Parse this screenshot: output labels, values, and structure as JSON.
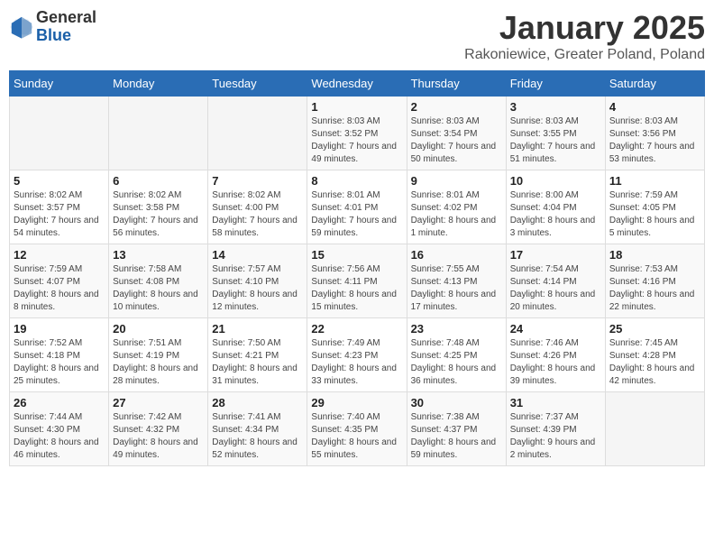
{
  "logo": {
    "line1": "General",
    "line2": "Blue"
  },
  "title": "January 2025",
  "subtitle": "Rakoniewice, Greater Poland, Poland",
  "weekdays": [
    "Sunday",
    "Monday",
    "Tuesday",
    "Wednesday",
    "Thursday",
    "Friday",
    "Saturday"
  ],
  "weeks": [
    [
      {
        "day": "",
        "sunrise": "",
        "sunset": "",
        "daylight": ""
      },
      {
        "day": "",
        "sunrise": "",
        "sunset": "",
        "daylight": ""
      },
      {
        "day": "",
        "sunrise": "",
        "sunset": "",
        "daylight": ""
      },
      {
        "day": "1",
        "sunrise": "Sunrise: 8:03 AM",
        "sunset": "Sunset: 3:52 PM",
        "daylight": "Daylight: 7 hours and 49 minutes."
      },
      {
        "day": "2",
        "sunrise": "Sunrise: 8:03 AM",
        "sunset": "Sunset: 3:54 PM",
        "daylight": "Daylight: 7 hours and 50 minutes."
      },
      {
        "day": "3",
        "sunrise": "Sunrise: 8:03 AM",
        "sunset": "Sunset: 3:55 PM",
        "daylight": "Daylight: 7 hours and 51 minutes."
      },
      {
        "day": "4",
        "sunrise": "Sunrise: 8:03 AM",
        "sunset": "Sunset: 3:56 PM",
        "daylight": "Daylight: 7 hours and 53 minutes."
      }
    ],
    [
      {
        "day": "5",
        "sunrise": "Sunrise: 8:02 AM",
        "sunset": "Sunset: 3:57 PM",
        "daylight": "Daylight: 7 hours and 54 minutes."
      },
      {
        "day": "6",
        "sunrise": "Sunrise: 8:02 AM",
        "sunset": "Sunset: 3:58 PM",
        "daylight": "Daylight: 7 hours and 56 minutes."
      },
      {
        "day": "7",
        "sunrise": "Sunrise: 8:02 AM",
        "sunset": "Sunset: 4:00 PM",
        "daylight": "Daylight: 7 hours and 58 minutes."
      },
      {
        "day": "8",
        "sunrise": "Sunrise: 8:01 AM",
        "sunset": "Sunset: 4:01 PM",
        "daylight": "Daylight: 7 hours and 59 minutes."
      },
      {
        "day": "9",
        "sunrise": "Sunrise: 8:01 AM",
        "sunset": "Sunset: 4:02 PM",
        "daylight": "Daylight: 8 hours and 1 minute."
      },
      {
        "day": "10",
        "sunrise": "Sunrise: 8:00 AM",
        "sunset": "Sunset: 4:04 PM",
        "daylight": "Daylight: 8 hours and 3 minutes."
      },
      {
        "day": "11",
        "sunrise": "Sunrise: 7:59 AM",
        "sunset": "Sunset: 4:05 PM",
        "daylight": "Daylight: 8 hours and 5 minutes."
      }
    ],
    [
      {
        "day": "12",
        "sunrise": "Sunrise: 7:59 AM",
        "sunset": "Sunset: 4:07 PM",
        "daylight": "Daylight: 8 hours and 8 minutes."
      },
      {
        "day": "13",
        "sunrise": "Sunrise: 7:58 AM",
        "sunset": "Sunset: 4:08 PM",
        "daylight": "Daylight: 8 hours and 10 minutes."
      },
      {
        "day": "14",
        "sunrise": "Sunrise: 7:57 AM",
        "sunset": "Sunset: 4:10 PM",
        "daylight": "Daylight: 8 hours and 12 minutes."
      },
      {
        "day": "15",
        "sunrise": "Sunrise: 7:56 AM",
        "sunset": "Sunset: 4:11 PM",
        "daylight": "Daylight: 8 hours and 15 minutes."
      },
      {
        "day": "16",
        "sunrise": "Sunrise: 7:55 AM",
        "sunset": "Sunset: 4:13 PM",
        "daylight": "Daylight: 8 hours and 17 minutes."
      },
      {
        "day": "17",
        "sunrise": "Sunrise: 7:54 AM",
        "sunset": "Sunset: 4:14 PM",
        "daylight": "Daylight: 8 hours and 20 minutes."
      },
      {
        "day": "18",
        "sunrise": "Sunrise: 7:53 AM",
        "sunset": "Sunset: 4:16 PM",
        "daylight": "Daylight: 8 hours and 22 minutes."
      }
    ],
    [
      {
        "day": "19",
        "sunrise": "Sunrise: 7:52 AM",
        "sunset": "Sunset: 4:18 PM",
        "daylight": "Daylight: 8 hours and 25 minutes."
      },
      {
        "day": "20",
        "sunrise": "Sunrise: 7:51 AM",
        "sunset": "Sunset: 4:19 PM",
        "daylight": "Daylight: 8 hours and 28 minutes."
      },
      {
        "day": "21",
        "sunrise": "Sunrise: 7:50 AM",
        "sunset": "Sunset: 4:21 PM",
        "daylight": "Daylight: 8 hours and 31 minutes."
      },
      {
        "day": "22",
        "sunrise": "Sunrise: 7:49 AM",
        "sunset": "Sunset: 4:23 PM",
        "daylight": "Daylight: 8 hours and 33 minutes."
      },
      {
        "day": "23",
        "sunrise": "Sunrise: 7:48 AM",
        "sunset": "Sunset: 4:25 PM",
        "daylight": "Daylight: 8 hours and 36 minutes."
      },
      {
        "day": "24",
        "sunrise": "Sunrise: 7:46 AM",
        "sunset": "Sunset: 4:26 PM",
        "daylight": "Daylight: 8 hours and 39 minutes."
      },
      {
        "day": "25",
        "sunrise": "Sunrise: 7:45 AM",
        "sunset": "Sunset: 4:28 PM",
        "daylight": "Daylight: 8 hours and 42 minutes."
      }
    ],
    [
      {
        "day": "26",
        "sunrise": "Sunrise: 7:44 AM",
        "sunset": "Sunset: 4:30 PM",
        "daylight": "Daylight: 8 hours and 46 minutes."
      },
      {
        "day": "27",
        "sunrise": "Sunrise: 7:42 AM",
        "sunset": "Sunset: 4:32 PM",
        "daylight": "Daylight: 8 hours and 49 minutes."
      },
      {
        "day": "28",
        "sunrise": "Sunrise: 7:41 AM",
        "sunset": "Sunset: 4:34 PM",
        "daylight": "Daylight: 8 hours and 52 minutes."
      },
      {
        "day": "29",
        "sunrise": "Sunrise: 7:40 AM",
        "sunset": "Sunset: 4:35 PM",
        "daylight": "Daylight: 8 hours and 55 minutes."
      },
      {
        "day": "30",
        "sunrise": "Sunrise: 7:38 AM",
        "sunset": "Sunset: 4:37 PM",
        "daylight": "Daylight: 8 hours and 59 minutes."
      },
      {
        "day": "31",
        "sunrise": "Sunrise: 7:37 AM",
        "sunset": "Sunset: 4:39 PM",
        "daylight": "Daylight: 9 hours and 2 minutes."
      },
      {
        "day": "",
        "sunrise": "",
        "sunset": "",
        "daylight": ""
      }
    ]
  ]
}
